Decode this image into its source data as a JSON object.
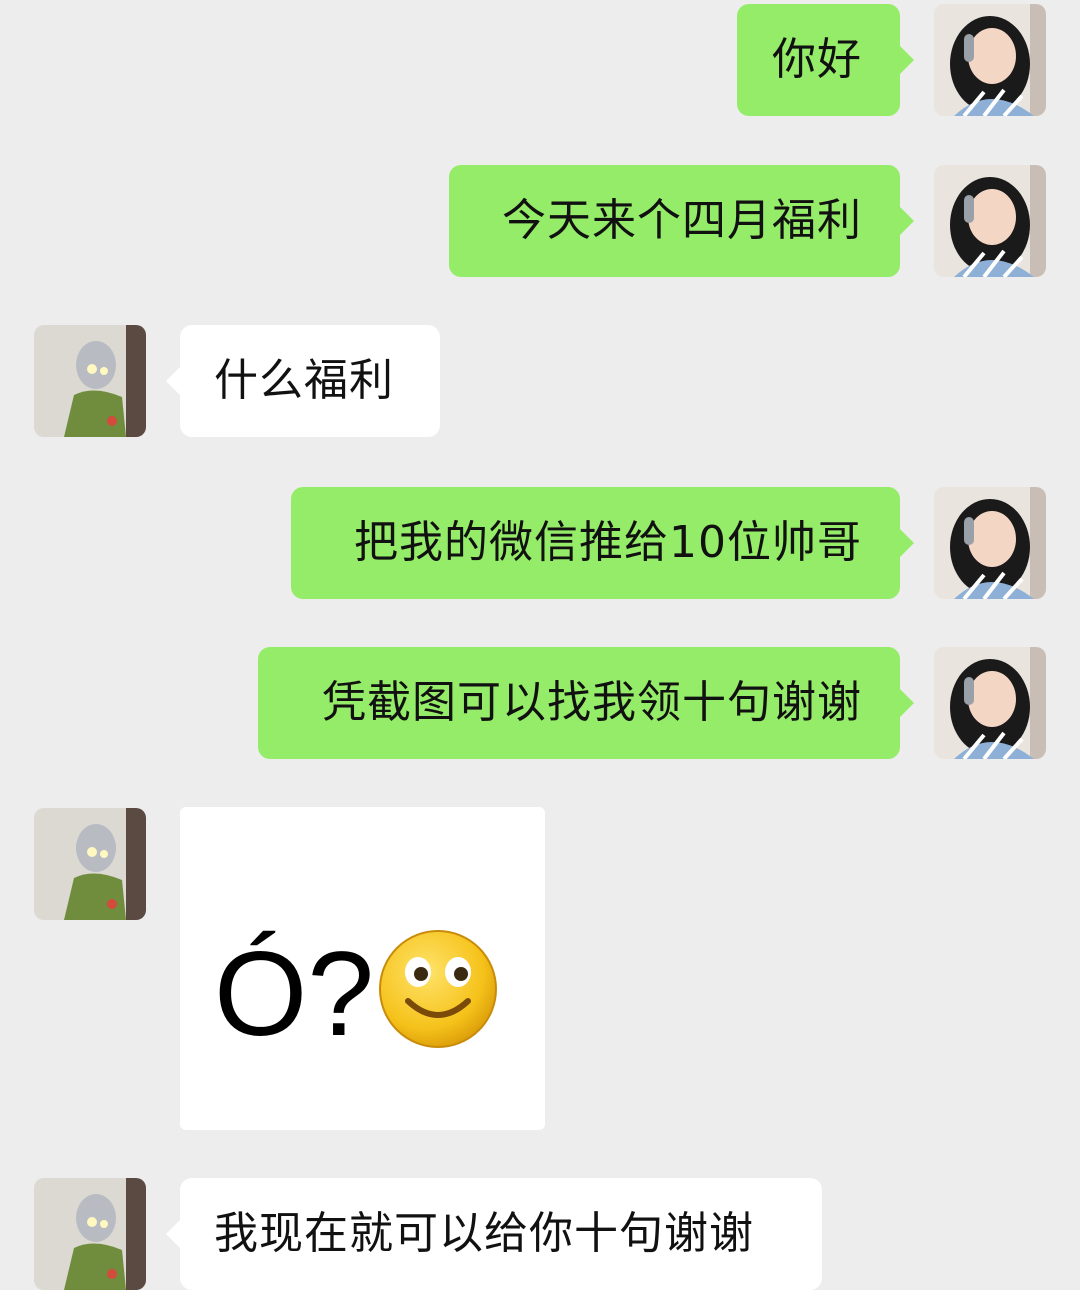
{
  "messages": [
    {
      "sender": "self",
      "text": "你好"
    },
    {
      "sender": "self",
      "text": "今天来个四月福利"
    },
    {
      "sender": "peer",
      "text": "什么福利"
    },
    {
      "sender": "self",
      "text": "把我的微信推给10位帅哥"
    },
    {
      "sender": "self",
      "text": "凭截图可以找我领十句谢谢"
    },
    {
      "sender": "peer",
      "sticker_text": "Ó?",
      "sticker_icon": "smiley-emoji-icon"
    },
    {
      "sender": "peer",
      "text": "我现在就可以给你十句谢谢"
    }
  ],
  "colors": {
    "background": "#ededed",
    "self_bubble": "#95ec69",
    "peer_bubble": "#ffffff"
  }
}
